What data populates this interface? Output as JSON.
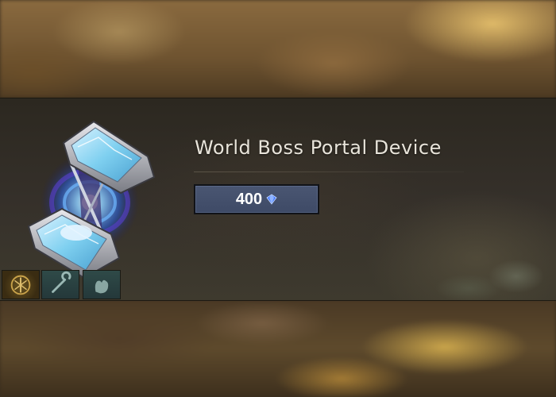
{
  "item": {
    "name": "World Boss Portal Device",
    "price": "400",
    "currency_icon": "blue-gem-icon"
  },
  "slots": [
    {
      "icon": "compass-emblem-icon"
    },
    {
      "icon": "wrench-icon"
    },
    {
      "icon": "hand-icon"
    }
  ],
  "colors": {
    "price_box": "#4a5672",
    "title_text": "#e8e4da",
    "gem": "#4a7cff",
    "portal_glow": "#4fa8ff"
  }
}
